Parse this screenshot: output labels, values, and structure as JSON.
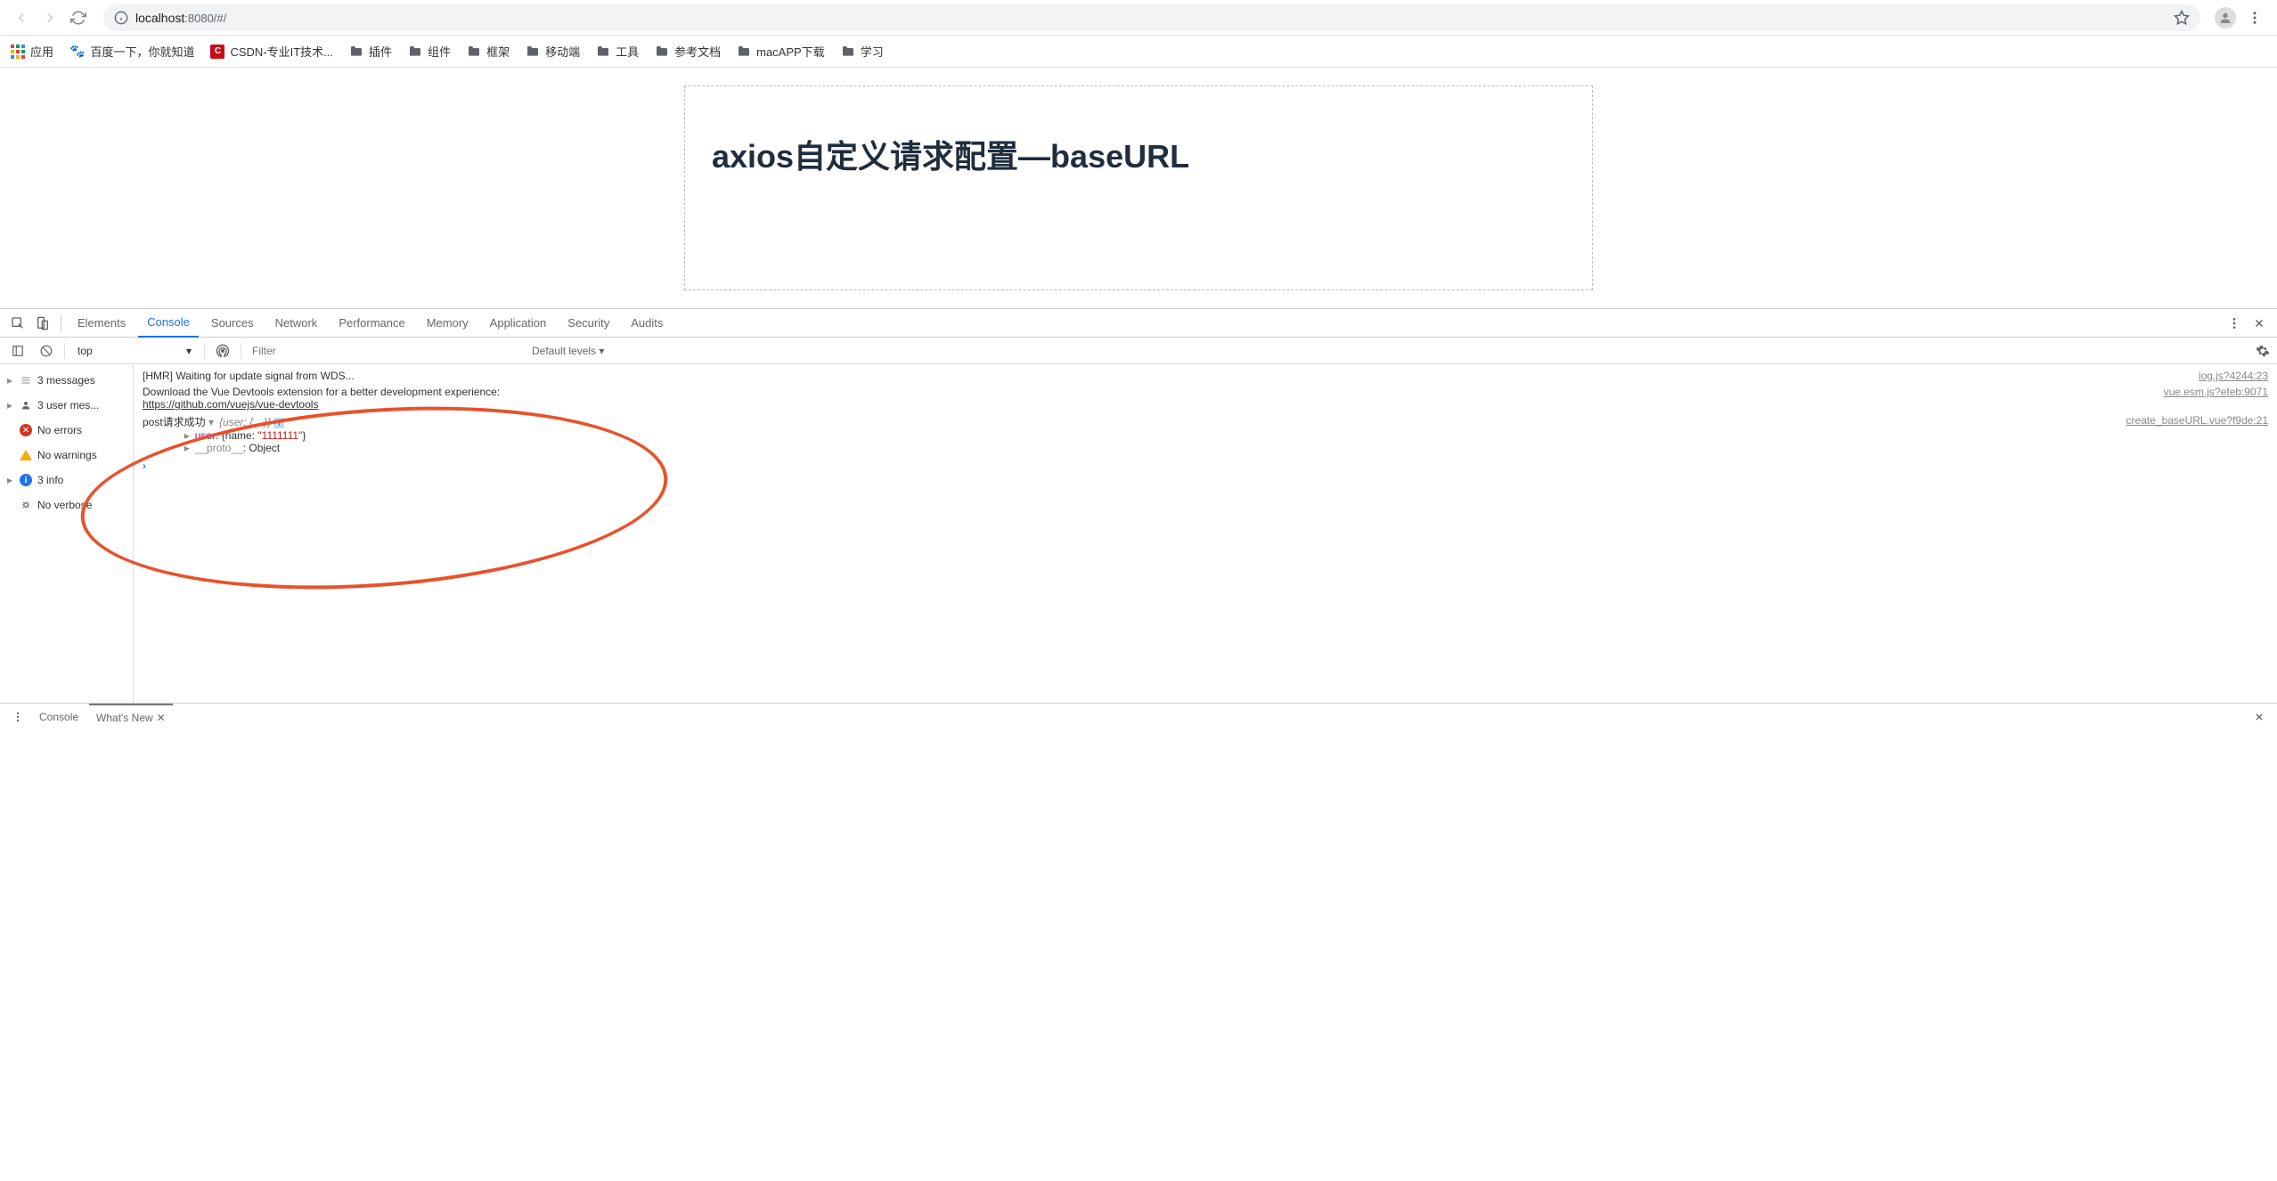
{
  "browser": {
    "url_host": "localhost",
    "url_rest": ":8080/#/",
    "bookmarks": {
      "apps": "应用",
      "baidu": "百度一下，你就知道",
      "csdn": "CSDN-专业IT技术...",
      "plugins": "插件",
      "components": "组件",
      "framework": "框架",
      "mobile": "移动端",
      "tools": "工具",
      "refdocs": "参考文档",
      "macapp": "macAPP下载",
      "study": "学习"
    }
  },
  "page": {
    "heading": "axios自定义请求配置—baseURL"
  },
  "devtools": {
    "tabs": {
      "elements": "Elements",
      "console": "Console",
      "sources": "Sources",
      "network": "Network",
      "performance": "Performance",
      "memory": "Memory",
      "application": "Application",
      "security": "Security",
      "audits": "Audits"
    },
    "filterbar": {
      "context": "top",
      "filter_placeholder": "Filter",
      "levels": "Default levels ▾"
    },
    "sidebar": {
      "messages": "3 messages",
      "usermes": "3 user mes...",
      "noerrors": "No errors",
      "nowarnings": "No warnings",
      "info": "3 info",
      "noverbose": "No verbose"
    },
    "logs": {
      "hmr": "[HMR] Waiting for update signal from WDS...",
      "hmr_src": "log.js?4244:23",
      "vuedev1": "Download the Vue Devtools extension for a better development experience:",
      "vuedev2": "https://github.com/vuejs/vue-devtools",
      "vuedev_src": "vue.esm.js?efeb:9071",
      "post_label": "post请求成功 ",
      "post_preview": "{user: {…}}",
      "post_src": "create_baseURL.vue?f9de:21",
      "user_key": "user",
      "user_val_open": "{name: ",
      "user_val_str": "\"1111111\"",
      "user_val_close": "}",
      "proto_key": "__proto__",
      "proto_val": ": Object"
    }
  },
  "drawer": {
    "console": "Console",
    "whatsnew": "What's New"
  }
}
